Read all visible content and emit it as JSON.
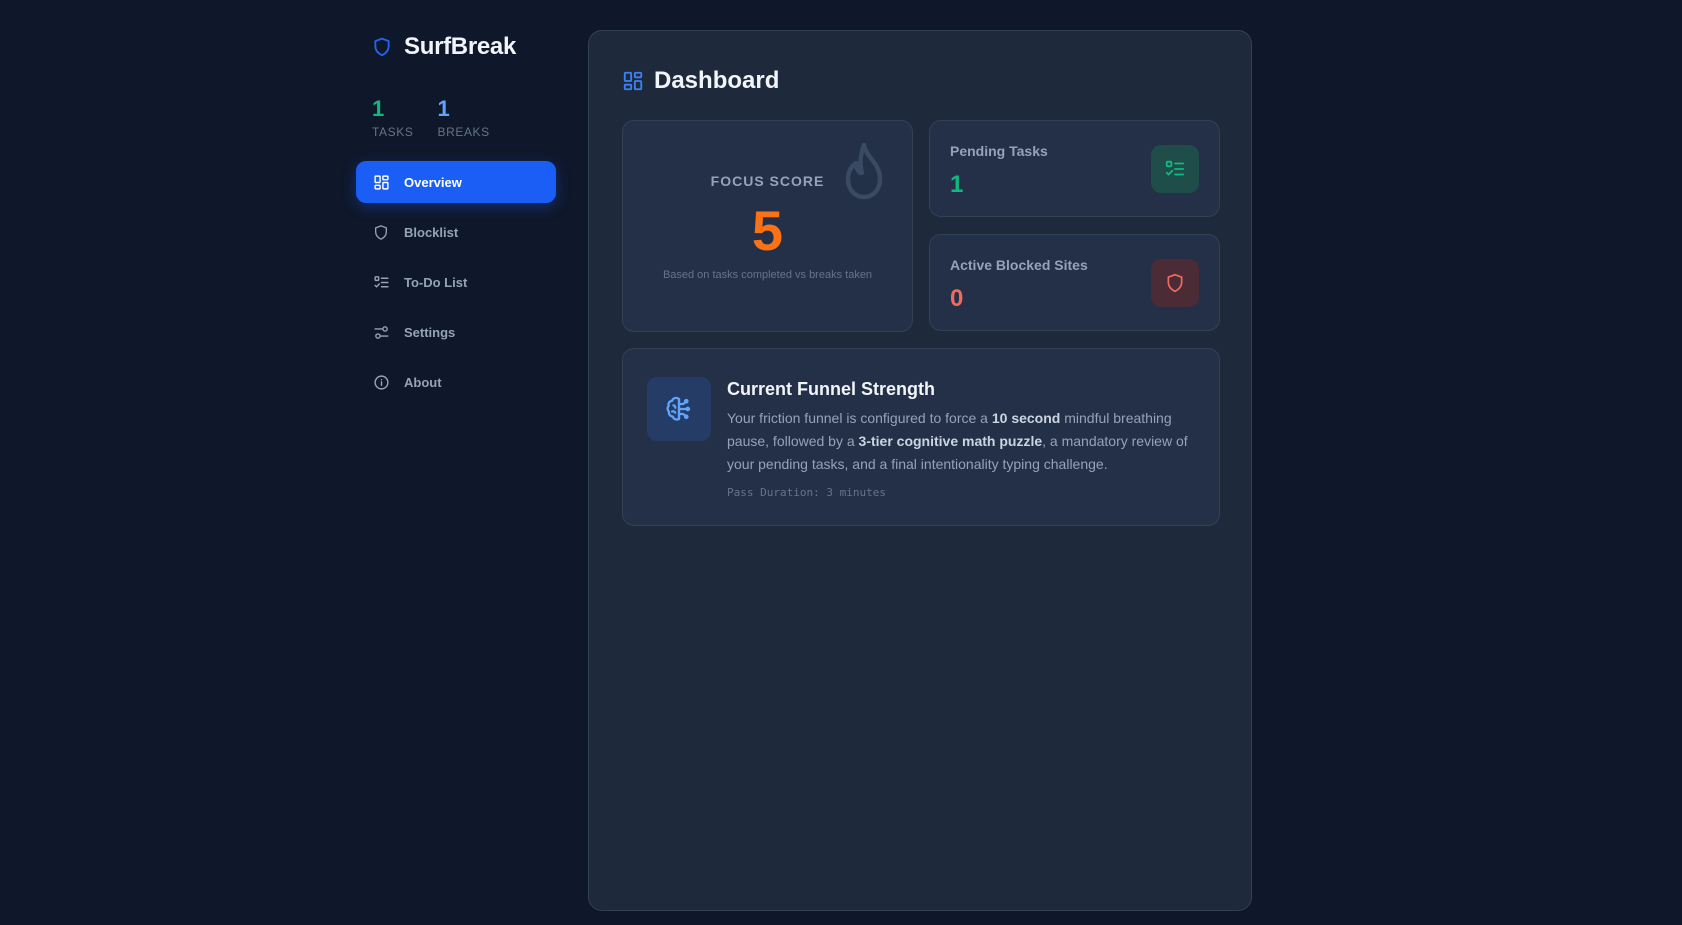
{
  "brand": {
    "title": "SurfBreak",
    "icon": "shield-icon"
  },
  "stats": {
    "tasks": {
      "value": "1",
      "label": "TASKS"
    },
    "breaks": {
      "value": "1",
      "label": "BREAKS"
    }
  },
  "nav": {
    "items": [
      {
        "label": "Overview",
        "icon": "grid-icon",
        "active": true
      },
      {
        "label": "Blocklist",
        "icon": "shield-icon"
      },
      {
        "label": "To-Do List",
        "icon": "checklist-icon"
      },
      {
        "label": "Settings",
        "icon": "sliders-icon"
      },
      {
        "label": "About",
        "icon": "info-icon"
      }
    ]
  },
  "main": {
    "title": "Dashboard",
    "focus": {
      "label": "FOCUS SCORE",
      "score": "5",
      "subtitle": "Based on tasks completed vs breaks taken"
    },
    "pending": {
      "label": "Pending Tasks",
      "value": "1"
    },
    "blocked": {
      "label": "Active Blocked Sites",
      "value": "0"
    },
    "funnel": {
      "title": "Current Funnel Strength",
      "text_1": "Your friction funnel is configured to force a ",
      "bold_1": "10 second",
      "text_2": " mindful breathing pause, followed by a ",
      "bold_2": "3-tier cognitive math puzzle",
      "text_3": ", a mandatory review of your pending tasks, and a final intentionality typing challenge.",
      "meta": "Pass Duration: 3 minutes"
    }
  },
  "colors": {
    "accent": "#1b5ef5",
    "green": "#10b981",
    "orange": "#f97316",
    "red": "#ef6b5b",
    "background": "#0f172a",
    "panel": "#1e293b"
  }
}
